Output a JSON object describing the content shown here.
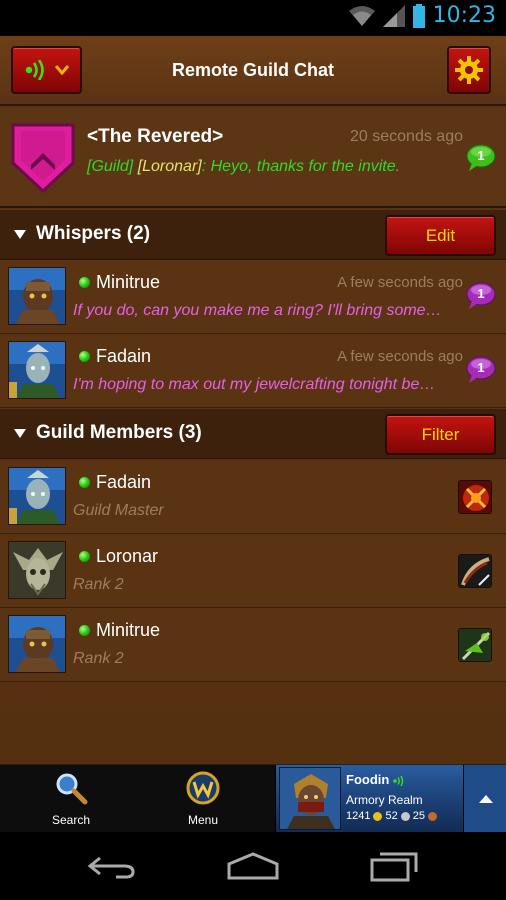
{
  "status_bar": {
    "time": "10:23"
  },
  "app": {
    "title": "Remote Guild Chat"
  },
  "guild": {
    "name": "<The Revered>",
    "time": "20 seconds ago",
    "channel": "[Guild] ",
    "sender": "[Loronar]",
    "message": ": Heyo, thanks for the invite.",
    "unread": "1"
  },
  "whispers": {
    "header": "Whispers (2)",
    "button": "Edit",
    "items": [
      {
        "name": "Minitrue",
        "time": "A few seconds ago",
        "message": "If you do, can you make me a ring?  I'll bring some…",
        "unread": "1"
      },
      {
        "name": "Fadain",
        "time": "A few seconds ago",
        "message": "I'm hoping to max out my jewelcrafting tonight be…",
        "unread": "1"
      }
    ]
  },
  "members": {
    "header": "Guild Members (3)",
    "button": "Filter",
    "items": [
      {
        "name": "Fadain",
        "rank": "Guild Master",
        "class_icon": "warrior-icon"
      },
      {
        "name": "Loronar",
        "rank": "Rank 2",
        "class_icon": "rogue-icon"
      },
      {
        "name": "Minitrue",
        "rank": "Rank 2",
        "class_icon": "hunter-icon"
      }
    ]
  },
  "bottom_nav": {
    "search_label": "Search",
    "menu_label": "Menu"
  },
  "character": {
    "name": "Foodin",
    "realm": "Armory Realm",
    "gold": "1241",
    "silver": "52",
    "copper": "25"
  },
  "colors": {
    "guild_text": "#2ddb28",
    "whisper_text": "#e660e6",
    "accent_button": "#c41410",
    "button_text": "#f8d800"
  }
}
